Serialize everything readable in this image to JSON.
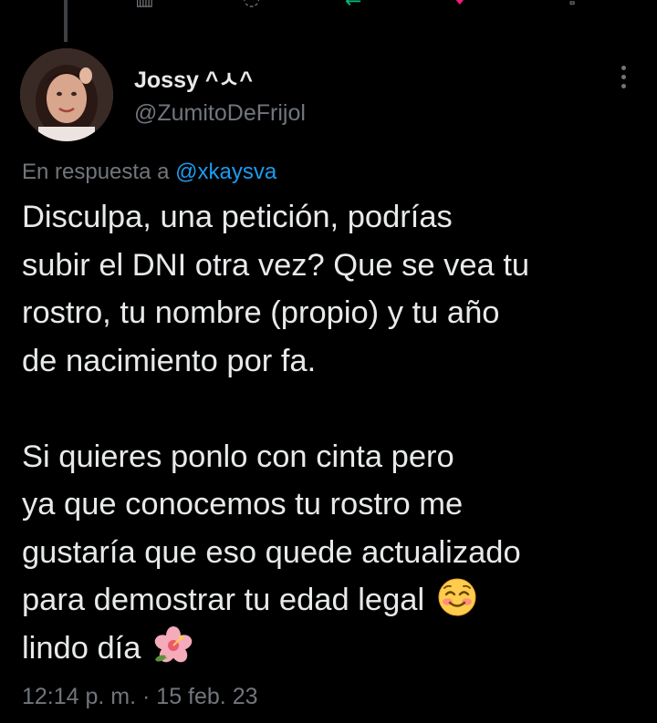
{
  "colors": {
    "background": "#000000",
    "primary_text": "#e7e9ea",
    "secondary_text": "#71767b",
    "link": "#1d9bf0",
    "retweet_green": "#00ba7c",
    "like_pink": "#f91880"
  },
  "tweet": {
    "author": {
      "display_name": "Jossy ^ㅅ^",
      "handle": "@ZumitoDeFrijol",
      "avatar_icon": "avatar"
    },
    "more_icon": "more-vertical-icon",
    "reply_context": {
      "prefix": "En respuesta a ",
      "mention": "@xkaysva"
    },
    "body_lines": [
      "Disculpa, una petición, podrías",
      "subir el DNI otra vez? Que se vea tu",
      "rostro, tu nombre (propio) y tu año",
      "de nacimiento por fa.",
      "",
      "Si quieres ponlo con cinta pero",
      "ya que conocemos tu rostro me",
      "gustaría que eso quede actualizado",
      "para demostrar tu edad legal",
      "lindo día"
    ],
    "emojis": {
      "smiling_blush": "smiling-face-with-smiling-eyes-icon",
      "hibiscus": "hibiscus-icon"
    },
    "timestamp": "12:14 p. m. · 15 feb. 23"
  }
}
